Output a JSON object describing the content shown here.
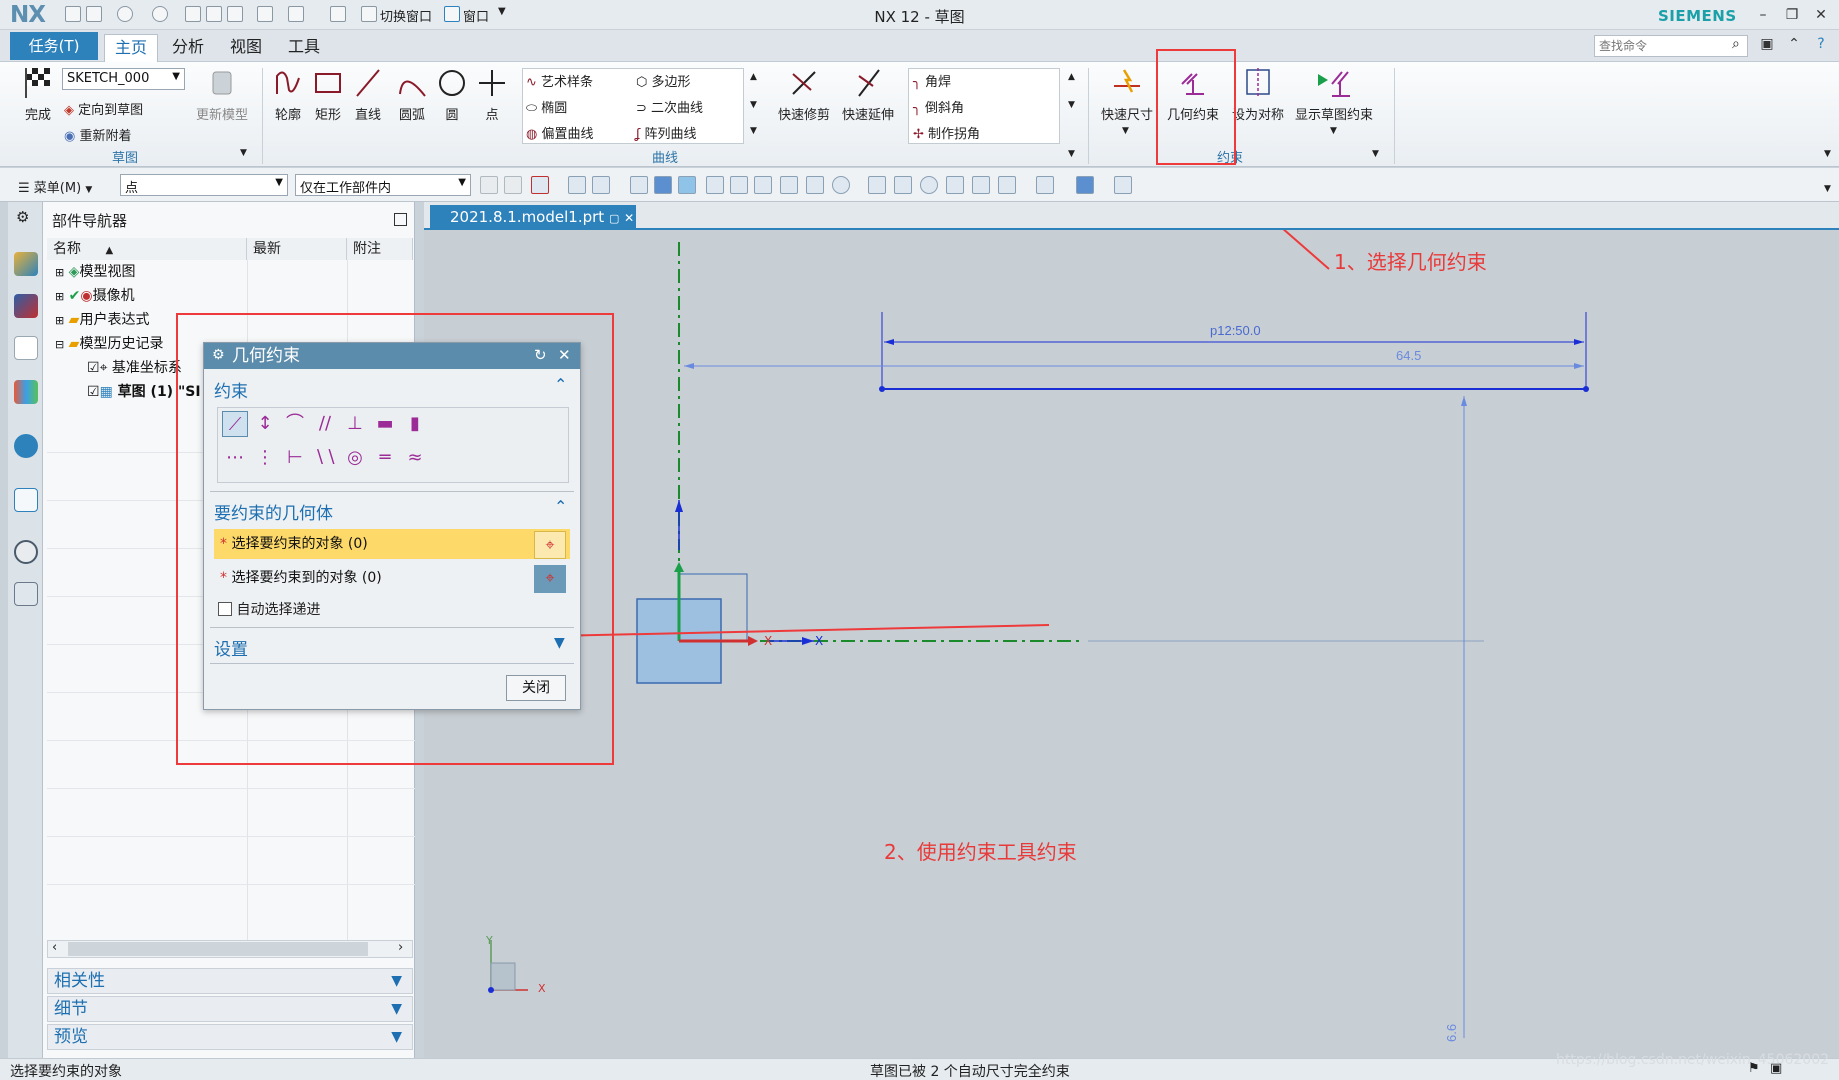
{
  "app": {
    "logo": "NX",
    "title": "NX 12 - 草图",
    "brand": "SIEMENS",
    "quick_access": {
      "switch_window": "切换窗口",
      "window": "窗口"
    }
  },
  "tabs": {
    "task": "任务(T)",
    "home": "主页",
    "analysis": "分析",
    "view": "视图",
    "tools": "工具"
  },
  "search": {
    "placeholder": "查找命令"
  },
  "ribbon": {
    "sketch_group": {
      "finish": "完成",
      "sketch_name": "SKETCH_000",
      "orient": "定向到草图",
      "reattach": "重新附着",
      "update_model": "更新模型",
      "label": "草图"
    },
    "curve_group": {
      "profile": "轮廓",
      "rectangle": "矩形",
      "line": "直线",
      "arc": "圆弧",
      "circle": "圆",
      "point": "点",
      "studio_spline": "艺术样条",
      "polygon": "多边形",
      "ellipse": "椭圆",
      "conic": "二次曲线",
      "offset_curve": "偏置曲线",
      "pattern_curve": "阵列曲线",
      "label": "曲线"
    },
    "edit_group": {
      "quick_trim": "快速修剪",
      "quick_extend": "快速延伸",
      "fillet": "角焊",
      "chamfer": "倒斜角",
      "make_corner": "制作拐角"
    },
    "constraint_group": {
      "rapid_dimension": "快速尺寸",
      "geometric_constraints": "几何约束",
      "make_symmetric": "设为对称",
      "show_constraints": "显示草图约束",
      "label": "约束"
    }
  },
  "toolbar2": {
    "menu": "菜单(M)",
    "filter_type": "点",
    "filter_scope": "仅在工作部件内"
  },
  "navigator": {
    "title": "部件导航器",
    "columns": [
      "名称",
      "最新",
      "附注"
    ],
    "items": [
      "模型视图",
      "摄像机",
      "用户表达式",
      "模型历史记录",
      "基准坐标系",
      "草图 (1) \"SI"
    ],
    "panels": [
      "相关性",
      "细节",
      "预览"
    ]
  },
  "document_tab": "2021.8.1.model1.prt",
  "dialog": {
    "title": "几何约束",
    "section_constraints": "约束",
    "section_geometry": "要约束的几何体",
    "select_object": "选择要约束的对象 (0)",
    "select_target": "选择要约束到的对象 (0)",
    "auto_select": "自动选择递进",
    "section_settings": "设置",
    "close": "关闭"
  },
  "sketch": {
    "dim_top": "p12:50.0",
    "dim_width": "64.5",
    "dim_height": "6.6"
  },
  "annotations": {
    "step1": "1、选择几何约束",
    "step2": "2、使用约束工具约束"
  },
  "status": {
    "left": "选择要约束的对象",
    "center": "草图已被 2 个自动尺寸完全约束",
    "watermark": "https://blog.csdn.net/weixin_45062002"
  },
  "colors": {
    "accent": "#2e82bb",
    "dialog_header": "#5c8cab",
    "highlight_row": "#fdd96a",
    "annotation": "#e83a3a",
    "sketch_blue": "#1a2ed6"
  }
}
